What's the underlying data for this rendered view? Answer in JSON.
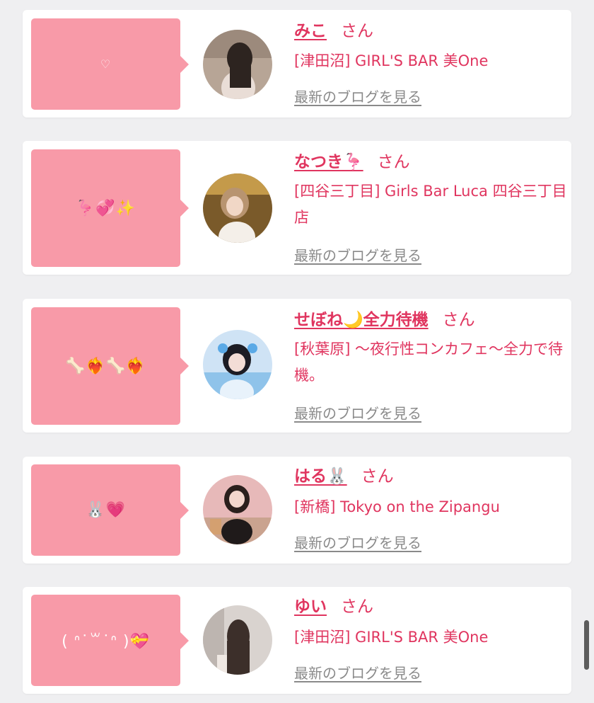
{
  "blog_link_label": "最新のブログを見る",
  "san_label": "さん",
  "colors": {
    "accent": "#e0355f",
    "bubble": "#f89aa8",
    "background": "#efeff1"
  },
  "cards": [
    {
      "message": "♡",
      "name": "みこ",
      "shop": "[津田沼] GIRL'S BAR 美One"
    },
    {
      "message": "🦩💞✨",
      "name": "なつき🦩",
      "shop": "[四谷三丁目] Girls Bar Luca 四谷三丁目店"
    },
    {
      "message": "🦴❤️‍🔥🦴❤️‍🔥",
      "name": "せぼね🌙全力待機",
      "shop": "[秋葉原] 〜夜行性コンカフェ〜全力で待機。"
    },
    {
      "message": "🐰💗",
      "name": "はる🐰",
      "shop": "[新橋] Tokyo on the Zipangu"
    },
    {
      "message": "( ᐢ˙꒳​˙ᐢ )💝",
      "name": "ゆい",
      "shop": "[津田沼] GIRL'S BAR 美One"
    }
  ]
}
